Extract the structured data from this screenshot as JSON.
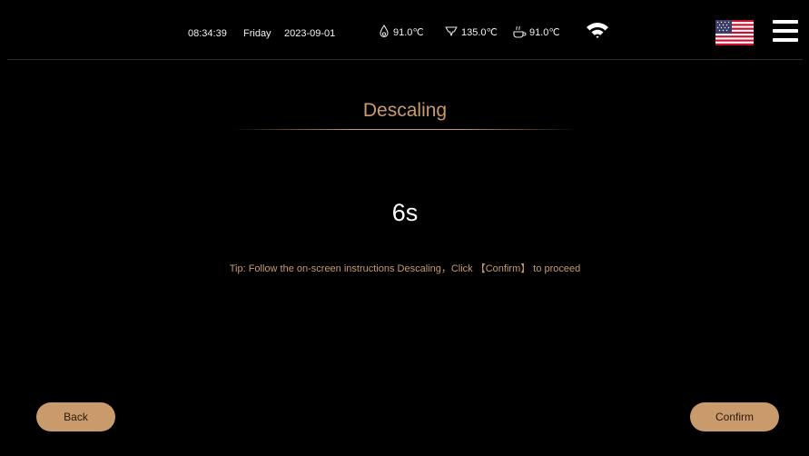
{
  "status_bar": {
    "time": "08:34:39",
    "day": "Friday",
    "date": "2023-09-01",
    "sensors": [
      {
        "icon": "water-drop-icon",
        "value": "91.0℃"
      },
      {
        "icon": "steam-icon",
        "value": "135.0℃"
      },
      {
        "icon": "coffee-cup-icon",
        "value": "91.0℃"
      }
    ],
    "wifi_icon": "wifi-icon",
    "language_icon": "us-flag-icon",
    "menu_icon": "hamburger-menu-icon"
  },
  "main": {
    "title": "Descaling",
    "countdown": "6s",
    "tip": "Tip: Follow the on-screen instructions Descaling，Click 【Confirm】 to proceed"
  },
  "buttons": {
    "back_label": "Back",
    "confirm_label": "Confirm"
  },
  "colors": {
    "accent": "#c99a6c",
    "background": "#000000",
    "text": "#ffffff"
  }
}
